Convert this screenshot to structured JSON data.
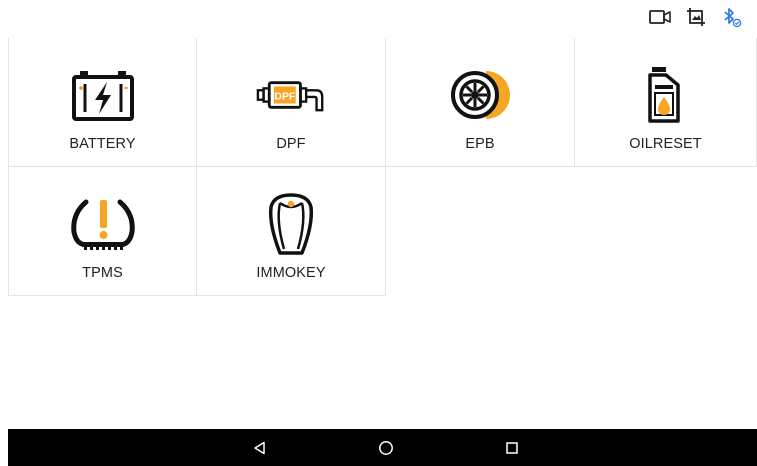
{
  "status_bar": {
    "icons": [
      "video-camera-icon",
      "image-crop-icon",
      "bluetooth-connected-icon"
    ],
    "bluetooth_color": "#2c7be5"
  },
  "functions": [
    {
      "label": "BATTERY",
      "icon": "battery-icon"
    },
    {
      "label": "DPF",
      "icon": "dpf-icon"
    },
    {
      "label": "EPB",
      "icon": "epb-brake-icon"
    },
    {
      "label": "OILRESET",
      "icon": "oil-reset-icon"
    },
    {
      "label": "TPMS",
      "icon": "tpms-tire-icon"
    },
    {
      "label": "IMMOKEY",
      "icon": "immo-key-icon"
    }
  ],
  "accent_color": "#f5a623",
  "nav_bar": {
    "buttons": [
      "back-icon",
      "home-icon",
      "recent-apps-icon"
    ]
  }
}
